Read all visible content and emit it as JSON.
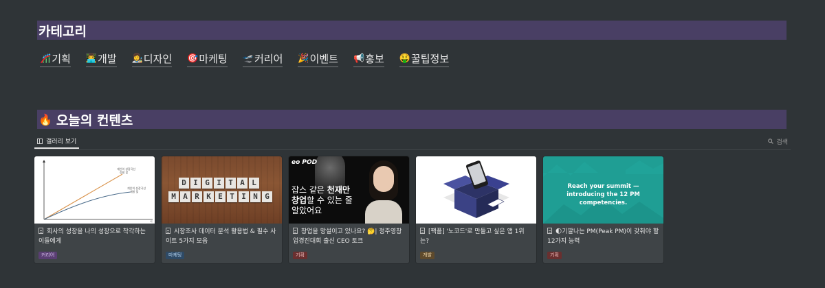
{
  "sections": {
    "categories_title": "카테고리",
    "today_title": "오늘의 컨텐츠",
    "today_emoji": "🔥"
  },
  "categories": [
    {
      "emoji": "🎢",
      "label": "기획"
    },
    {
      "emoji": "👨‍💻",
      "label": "개발"
    },
    {
      "emoji": "👩‍🎨",
      "label": "디자인"
    },
    {
      "emoji": "🎯",
      "label": "마케팅"
    },
    {
      "emoji": "🛫",
      "label": "커리어"
    },
    {
      "emoji": "🎉",
      "label": "이벤트"
    },
    {
      "emoji": "📢",
      "label": "홍보"
    },
    {
      "emoji": "🤑",
      "label": "꿀팁정보"
    }
  ],
  "view": {
    "tab_label": "갤러리 보기",
    "search_label": "검색"
  },
  "cards": [
    {
      "title": "회사의 성장을 나의 성장으로 착각하는 이들에게",
      "tag": "커리어",
      "tag_bg": "#5a3e73",
      "tag_fg": "#d9c3ef"
    },
    {
      "title": "시장조사 데이터 분석 활용법 & 필수 사이트 5가지 모음",
      "tag": "마케팅",
      "tag_bg": "#2e4a66",
      "tag_fg": "#b9d6f2"
    },
    {
      "title": "창업을 망설이고 있나요? 🤔| 정주영창업경진대회 출신 CEO 토크",
      "tag": "기획",
      "tag_bg": "#6a2f2f",
      "tag_fg": "#f2c2c2"
    },
    {
      "title": "[팩플] '노코드'로 만들고 싶은 앱 1위는?",
      "tag": "개발",
      "tag_bg": "#5e4a2c",
      "tag_fg": "#ecd3a6"
    },
    {
      "title": "🌓기깔나는 PM(Peak PM)이 갖춰야 할 12가지 능력",
      "tag": "기획",
      "tag_bg": "#6a2f2f",
      "tag_fg": "#f2c2c2"
    }
  ],
  "thumbs": {
    "chart_label_1": "개인의 성장곡선\n정말 맞",
    "chart_label_2": "개인의 성장곡선\n개발 맞",
    "chart_axis_x": "시",
    "digital_row1": [
      "D",
      "I",
      "G",
      "I",
      "T",
      "A",
      "L"
    ],
    "digital_row2": [
      "M",
      "A",
      "R",
      "K",
      "E",
      "T",
      "I",
      "N",
      "G"
    ],
    "eopod_logo": "eo POD",
    "eopod_line1": "잡스 같은 ",
    "eopod_line1_b": "천재만",
    "eopod_line2_b": "창업",
    "eopod_line2": "할 수 있는 줄",
    "eopod_line3": "알았어요",
    "summit_line1": "Reach your summit —",
    "summit_line2": "introducing the 12 PM competencies."
  }
}
